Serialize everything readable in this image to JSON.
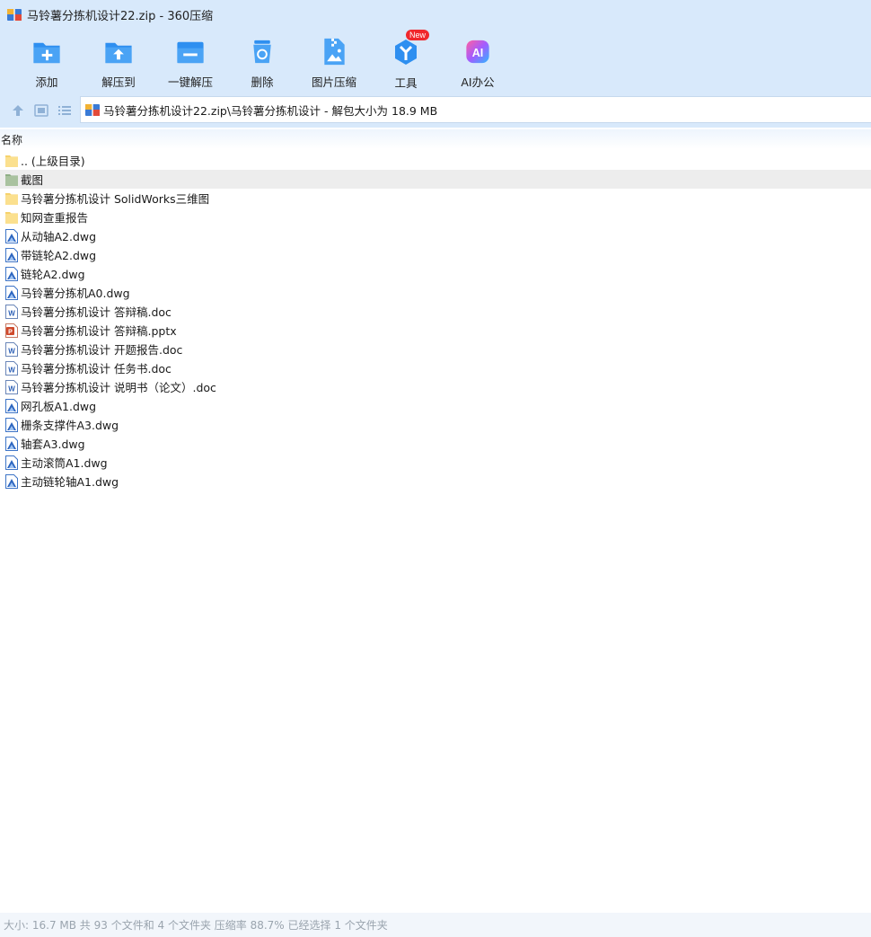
{
  "window": {
    "title": "马铃薯分拣机设计22.zip - 360压缩"
  },
  "toolbar": {
    "items": [
      {
        "label": "添加",
        "icon": "add-icon"
      },
      {
        "label": "解压到",
        "icon": "extract-to-icon"
      },
      {
        "label": "一键解压",
        "icon": "one-click-extract-icon"
      },
      {
        "label": "删除",
        "icon": "delete-icon"
      },
      {
        "label": "图片压缩",
        "icon": "image-compress-icon"
      },
      {
        "label": "工具",
        "icon": "tools-icon",
        "badge": "New"
      },
      {
        "label": "AI办公",
        "icon": "ai-office-icon",
        "icon_text": "AI"
      }
    ],
    "accent": "#2e8ff0"
  },
  "address": {
    "path": "马铃薯分拣机设计22.zip\\马铃薯分拣机设计 - 解包大小为 18.9 MB"
  },
  "list": {
    "column_name": "名称",
    "rows": [
      {
        "name": ".. (上级目录)",
        "type": "folder"
      },
      {
        "name": "截图",
        "type": "folder-selected",
        "selected": true
      },
      {
        "name": "马铃薯分拣机设计 SolidWorks三维图",
        "type": "folder"
      },
      {
        "name": "知网查重报告",
        "type": "folder"
      },
      {
        "name": "从动轴A2.dwg",
        "type": "dwg"
      },
      {
        "name": "带链轮A2.dwg",
        "type": "dwg"
      },
      {
        "name": "链轮A2.dwg",
        "type": "dwg"
      },
      {
        "name": "马铃薯分拣机A0.dwg",
        "type": "dwg"
      },
      {
        "name": "马铃薯分拣机设计 答辩稿.doc",
        "type": "doc"
      },
      {
        "name": "马铃薯分拣机设计 答辩稿.pptx",
        "type": "pptx"
      },
      {
        "name": "马铃薯分拣机设计 开题报告.doc",
        "type": "doc"
      },
      {
        "name": "马铃薯分拣机设计 任务书.doc",
        "type": "doc"
      },
      {
        "name": "马铃薯分拣机设计 说明书（论文）.doc",
        "type": "doc"
      },
      {
        "name": "网孔板A1.dwg",
        "type": "dwg"
      },
      {
        "name": "栅条支撑件A3.dwg",
        "type": "dwg"
      },
      {
        "name": "轴套A3.dwg",
        "type": "dwg"
      },
      {
        "name": "主动滚筒A1.dwg",
        "type": "dwg"
      },
      {
        "name": "主动链轮轴A1.dwg",
        "type": "dwg"
      }
    ]
  },
  "status": {
    "text": "大小: 16.7 MB 共 93 个文件和 4 个文件夹 压缩率 88.7% 已经选择 1 个文件夹"
  }
}
